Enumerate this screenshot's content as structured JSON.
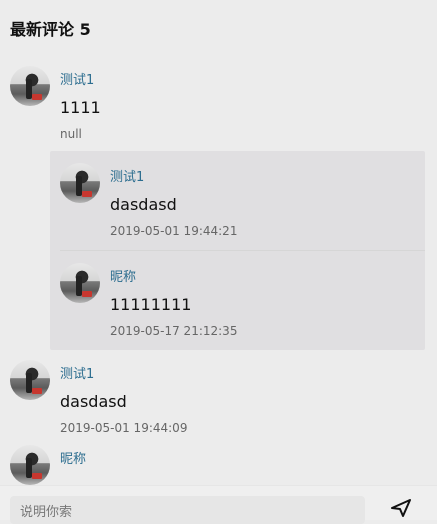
{
  "header": {
    "title": "最新评论 5"
  },
  "comments": [
    {
      "name": "测试1",
      "content": "1111",
      "meta": "null",
      "replies": [
        {
          "name": "测试1",
          "content": "dasdasd",
          "time": "2019-05-01 19:44:21"
        },
        {
          "name": "昵称",
          "content": "11111111",
          "time": "2019-05-17 21:12:35"
        }
      ]
    },
    {
      "name": "测试1",
      "content": "dasdasd",
      "meta": "2019-05-01 19:44:09"
    },
    {
      "name": "昵称"
    }
  ],
  "bottom": {
    "placeholder": "说明你索"
  }
}
